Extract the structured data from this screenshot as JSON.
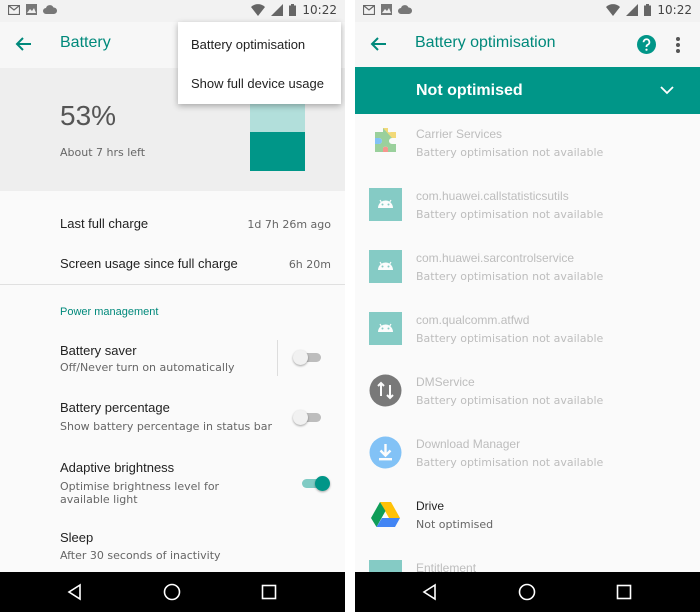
{
  "colors": {
    "accent": "#009688",
    "accent_dark": "#00897b",
    "battery_light": "#b2dfdb"
  },
  "left": {
    "status_bar": {
      "time": "10:22"
    },
    "title": "Battery",
    "battery": {
      "percent": "53%",
      "time_left": "About 7 hrs left",
      "level": 0.53
    },
    "menu": {
      "items": [
        "Battery optimisation",
        "Show full device usage"
      ]
    },
    "last_full_charge": {
      "label": "Last full charge",
      "value": "1d 7h 26m ago"
    },
    "screen_usage": {
      "label": "Screen usage since full charge",
      "value": "6h 20m"
    },
    "section": "Power management",
    "settings": [
      {
        "title": "Battery saver",
        "summary": "Off/Never turn on automatically",
        "on": false
      },
      {
        "title": "Battery percentage",
        "summary": "Show battery percentage in status bar",
        "on": false
      },
      {
        "title": "Adaptive brightness",
        "summary": "Optimise brightness level for available light",
        "on": true
      },
      {
        "title": "Sleep",
        "summary": "After 30 seconds of inactivity"
      }
    ]
  },
  "right": {
    "status_bar": {
      "time": "10:22"
    },
    "title": "Battery optimisation",
    "filter": "Not optimised",
    "apps": [
      {
        "name": "Carrier Services",
        "status": "Battery optimisation not available",
        "icon": "carrier-services-icon"
      },
      {
        "name": "com.huawei.callstatisticsutils",
        "status": "Battery optimisation not available",
        "icon": "android-icon"
      },
      {
        "name": "com.huawei.sarcontrolservice",
        "status": "Battery optimisation not available",
        "icon": "android-icon"
      },
      {
        "name": "com.qualcomm.atfwd",
        "status": "Battery optimisation not available",
        "icon": "android-icon"
      },
      {
        "name": "DMService",
        "status": "Battery optimisation not available",
        "icon": "dmservice-icon"
      },
      {
        "name": "Download Manager",
        "status": "Battery optimisation not available",
        "icon": "download-icon"
      },
      {
        "name": "Drive",
        "status": "Not optimised",
        "icon": "drive-icon"
      },
      {
        "name": "Entitlement",
        "status": "",
        "icon": "android-icon"
      }
    ]
  }
}
